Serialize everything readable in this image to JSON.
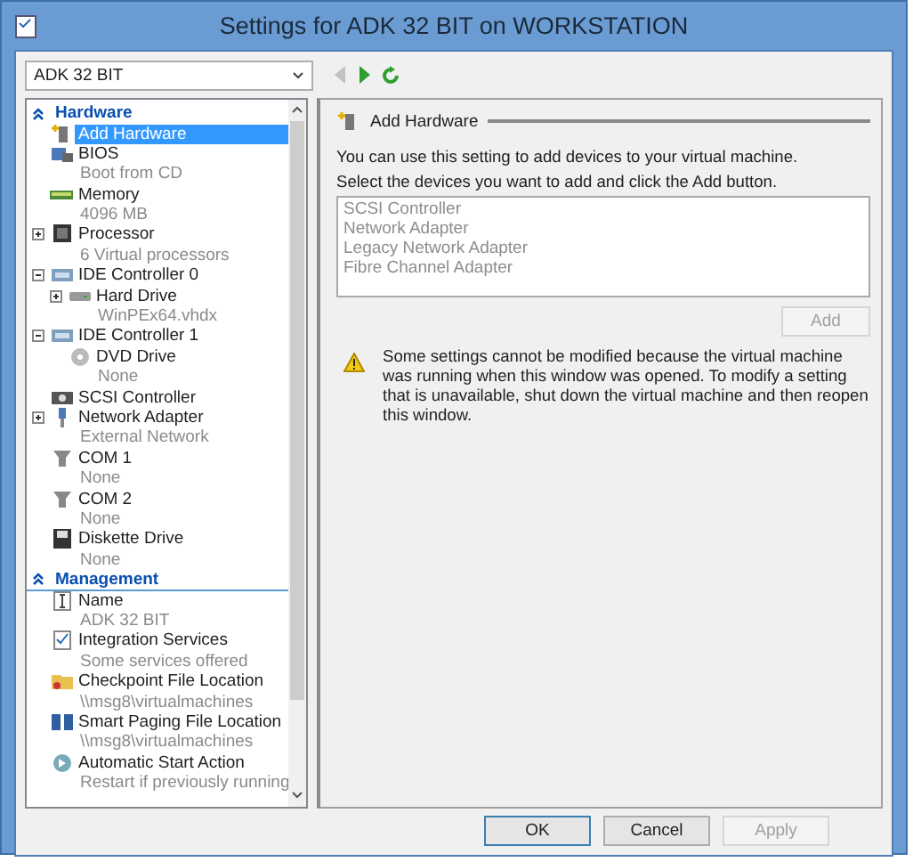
{
  "window": {
    "title": "Settings for ADK 32 BIT on WORKSTATION"
  },
  "vm_selector": {
    "value": "ADK 32 BIT"
  },
  "toolbar": {
    "back": {
      "disabled": true
    },
    "forward": {
      "disabled": false
    }
  },
  "sidebar": {
    "sections": [
      {
        "title": "Hardware",
        "expanded": true,
        "items": [
          {
            "label": "Add Hardware",
            "selected": true
          },
          {
            "label": "BIOS",
            "detail": "Boot from CD",
            "selected": false
          },
          {
            "label": "Memory",
            "detail": "4096 MB",
            "selected": false
          },
          {
            "label": "Processor",
            "detail": "6 Virtual processors",
            "expanded": false,
            "selected": false
          },
          {
            "label": "IDE Controller 0",
            "expanded": true,
            "selected": false,
            "children": [
              {
                "label": "Hard Drive",
                "detail": "WinPEx64.vhdx",
                "expanded": false,
                "selected": false
              }
            ]
          },
          {
            "label": "IDE Controller 1",
            "expanded": true,
            "selected": false,
            "children": [
              {
                "label": "DVD Drive",
                "detail": "None",
                "selected": false
              }
            ]
          },
          {
            "label": "SCSI Controller",
            "selected": false
          },
          {
            "label": "Network Adapter",
            "detail": "External Network",
            "expanded": false,
            "selected": false
          },
          {
            "label": "COM 1",
            "detail": "None",
            "selected": false
          },
          {
            "label": "COM 2",
            "detail": "None",
            "selected": false
          },
          {
            "label": "Diskette Drive",
            "detail": "None",
            "selected": false
          }
        ]
      },
      {
        "title": "Management",
        "expanded": true,
        "items": [
          {
            "label": "Name",
            "detail": "ADK 32 BIT",
            "selected": false
          },
          {
            "label": "Integration Services",
            "detail": "Some services offered",
            "selected": false
          },
          {
            "label": "Checkpoint File Location",
            "detail": "\\\\msg8\\virtualmachines",
            "selected": false
          },
          {
            "label": "Smart Paging File Location",
            "detail": "\\\\msg8\\virtualmachines",
            "selected": false
          },
          {
            "label": "Automatic Start Action",
            "detail": "Restart if previously running",
            "selected": false
          }
        ]
      }
    ]
  },
  "panel": {
    "title": "Add Hardware",
    "intro": "You can use this setting to add devices to your virtual machine.",
    "prompt": "Select the devices you want to add and click the Add button.",
    "devices": {
      "disabled": true,
      "items": [
        "SCSI Controller",
        "Network Adapter",
        "Legacy Network Adapter",
        "Fibre Channel Adapter"
      ]
    },
    "add_button": {
      "label": "Add",
      "disabled": true
    },
    "warning": "Some settings cannot be modified because the virtual machine was running when this window was opened. To modify a setting that is unavailable, shut down the virtual machine and then reopen this window."
  },
  "buttons": [
    {
      "label": "OK",
      "disabled": false,
      "default": true
    },
    {
      "label": "Cancel",
      "disabled": false,
      "default": false
    },
    {
      "label": "Apply",
      "disabled": true,
      "default": false
    }
  ]
}
